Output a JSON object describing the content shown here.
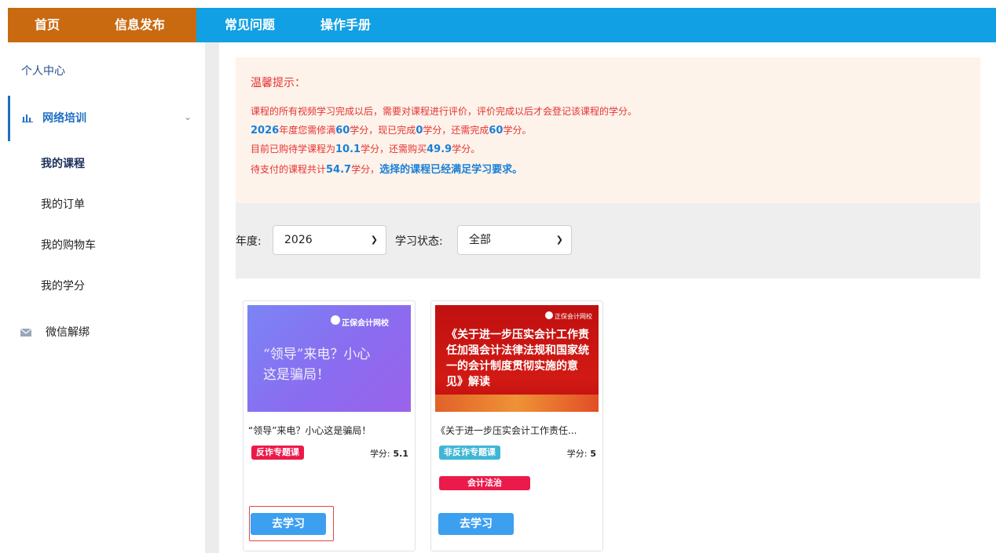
{
  "topnav": {
    "home": "首页",
    "publish": "信息发布",
    "faq": "常见问题",
    "manual": "操作手册"
  },
  "sidebar": {
    "header": "个人中心",
    "training": {
      "label": "网络培训",
      "icon": "bar-chart-icon"
    },
    "sub_items": [
      "我的课程",
      "我的订单",
      "我的购物车",
      "我的学分"
    ],
    "wechat": {
      "label": "微信解绑",
      "icon": "envelope-icon"
    }
  },
  "notice": {
    "title": "温馨提示：",
    "line1": "课程的所有视频学习完成以后，需要对课程进行评价，评价完成以后才会登记该课程的学分。",
    "line2": {
      "year": "2026",
      "a": "年度您需修满",
      "required": "60",
      "b": "学分，现已完成",
      "done": "0",
      "c": "学分，还需完成",
      "remaining": "60",
      "d": "学分。"
    },
    "line3": {
      "a": "目前已购待学课程为",
      "purchased": "10.1",
      "b": "学分，还需购买",
      "needed": "49.9",
      "c": "学分。"
    },
    "line4": {
      "a": "待支付的课程共计",
      "pending": "54.7",
      "b": "学分，",
      "status": "选择的课程已经满足学习要求。"
    }
  },
  "filter": {
    "year_label": "年度:",
    "year_value": "2026",
    "status_label": "学习状态:",
    "status_value": "全部"
  },
  "courses": [
    {
      "thumb_watermark": "正保会计网校",
      "thumb_headline": "“领导”来电？小心这是骗局！",
      "title": "“领导”来电？小心这是骗局！",
      "tag": "反诈专题课",
      "credit_label": "学分:",
      "credit_value": "5.1",
      "button": "去学习"
    },
    {
      "thumb_watermark": "正保会计网校",
      "thumb_headline": "《关于进一步压实会计工作责任加强会计法律法规和国家统一的会计制度贯彻实施的意见》解读",
      "title": "《关于进一步压实会计工作责任...",
      "tag": "非反诈专题课",
      "credit_label": "学分:",
      "credit_value": "5",
      "tag2": "会计法治",
      "button": "去学习"
    }
  ],
  "colors": {
    "nav_blue": "#10a0e3",
    "nav_orange": "#c96a10",
    "notice_red": "#e53333",
    "highlight_blue": "#1a7fd6",
    "tag_red": "#ec1a4a",
    "tag_cyan": "#3fb6d6",
    "button_blue": "#3c9ff0"
  }
}
